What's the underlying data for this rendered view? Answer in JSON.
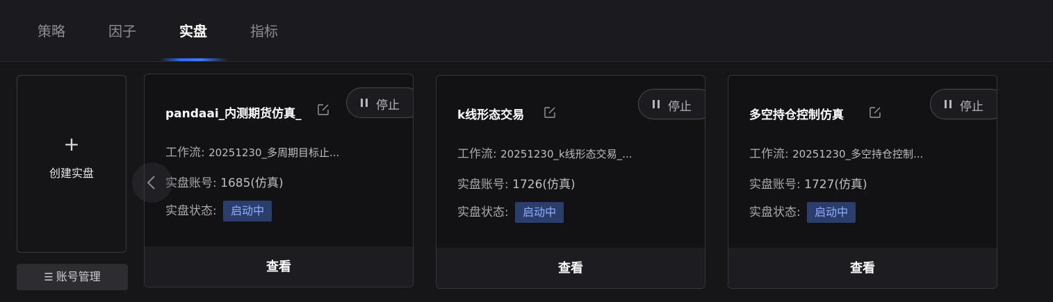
{
  "tabs": [
    {
      "label": "策略"
    },
    {
      "label": "因子"
    },
    {
      "label": "实盘"
    },
    {
      "label": "指标"
    }
  ],
  "active_tab": "实盘",
  "create_card": {
    "plus": "+",
    "label": "创建实盘"
  },
  "account_button": {
    "icon": "☰",
    "label": "账号管理"
  },
  "labels": {
    "workflow": "工作流:",
    "account": "实盘账号:",
    "status": "实盘状态:"
  },
  "cards": [
    {
      "title": "pandaai_内测期货仿真_",
      "stop_label": "停止",
      "workflow": "20251230_多周期目标止...",
      "account": "1685(仿真)",
      "status": "启动中",
      "view_label": "查看"
    },
    {
      "title": "k线形态交易",
      "stop_label": "停止",
      "workflow": "20251230_k线形态交易_...",
      "account": "1726(仿真)",
      "status": "启动中",
      "view_label": "查看"
    },
    {
      "title": "多空持仓控制仿真",
      "stop_label": "停止",
      "workflow": "20251230_多空持仓控制...",
      "account": "1727(仿真)",
      "status": "启动中",
      "view_label": "查看"
    }
  ],
  "colors": {
    "accent": "#2f6cf0",
    "badge_bg": "#2b3d6b",
    "badge_text": "#8fb0ff"
  }
}
